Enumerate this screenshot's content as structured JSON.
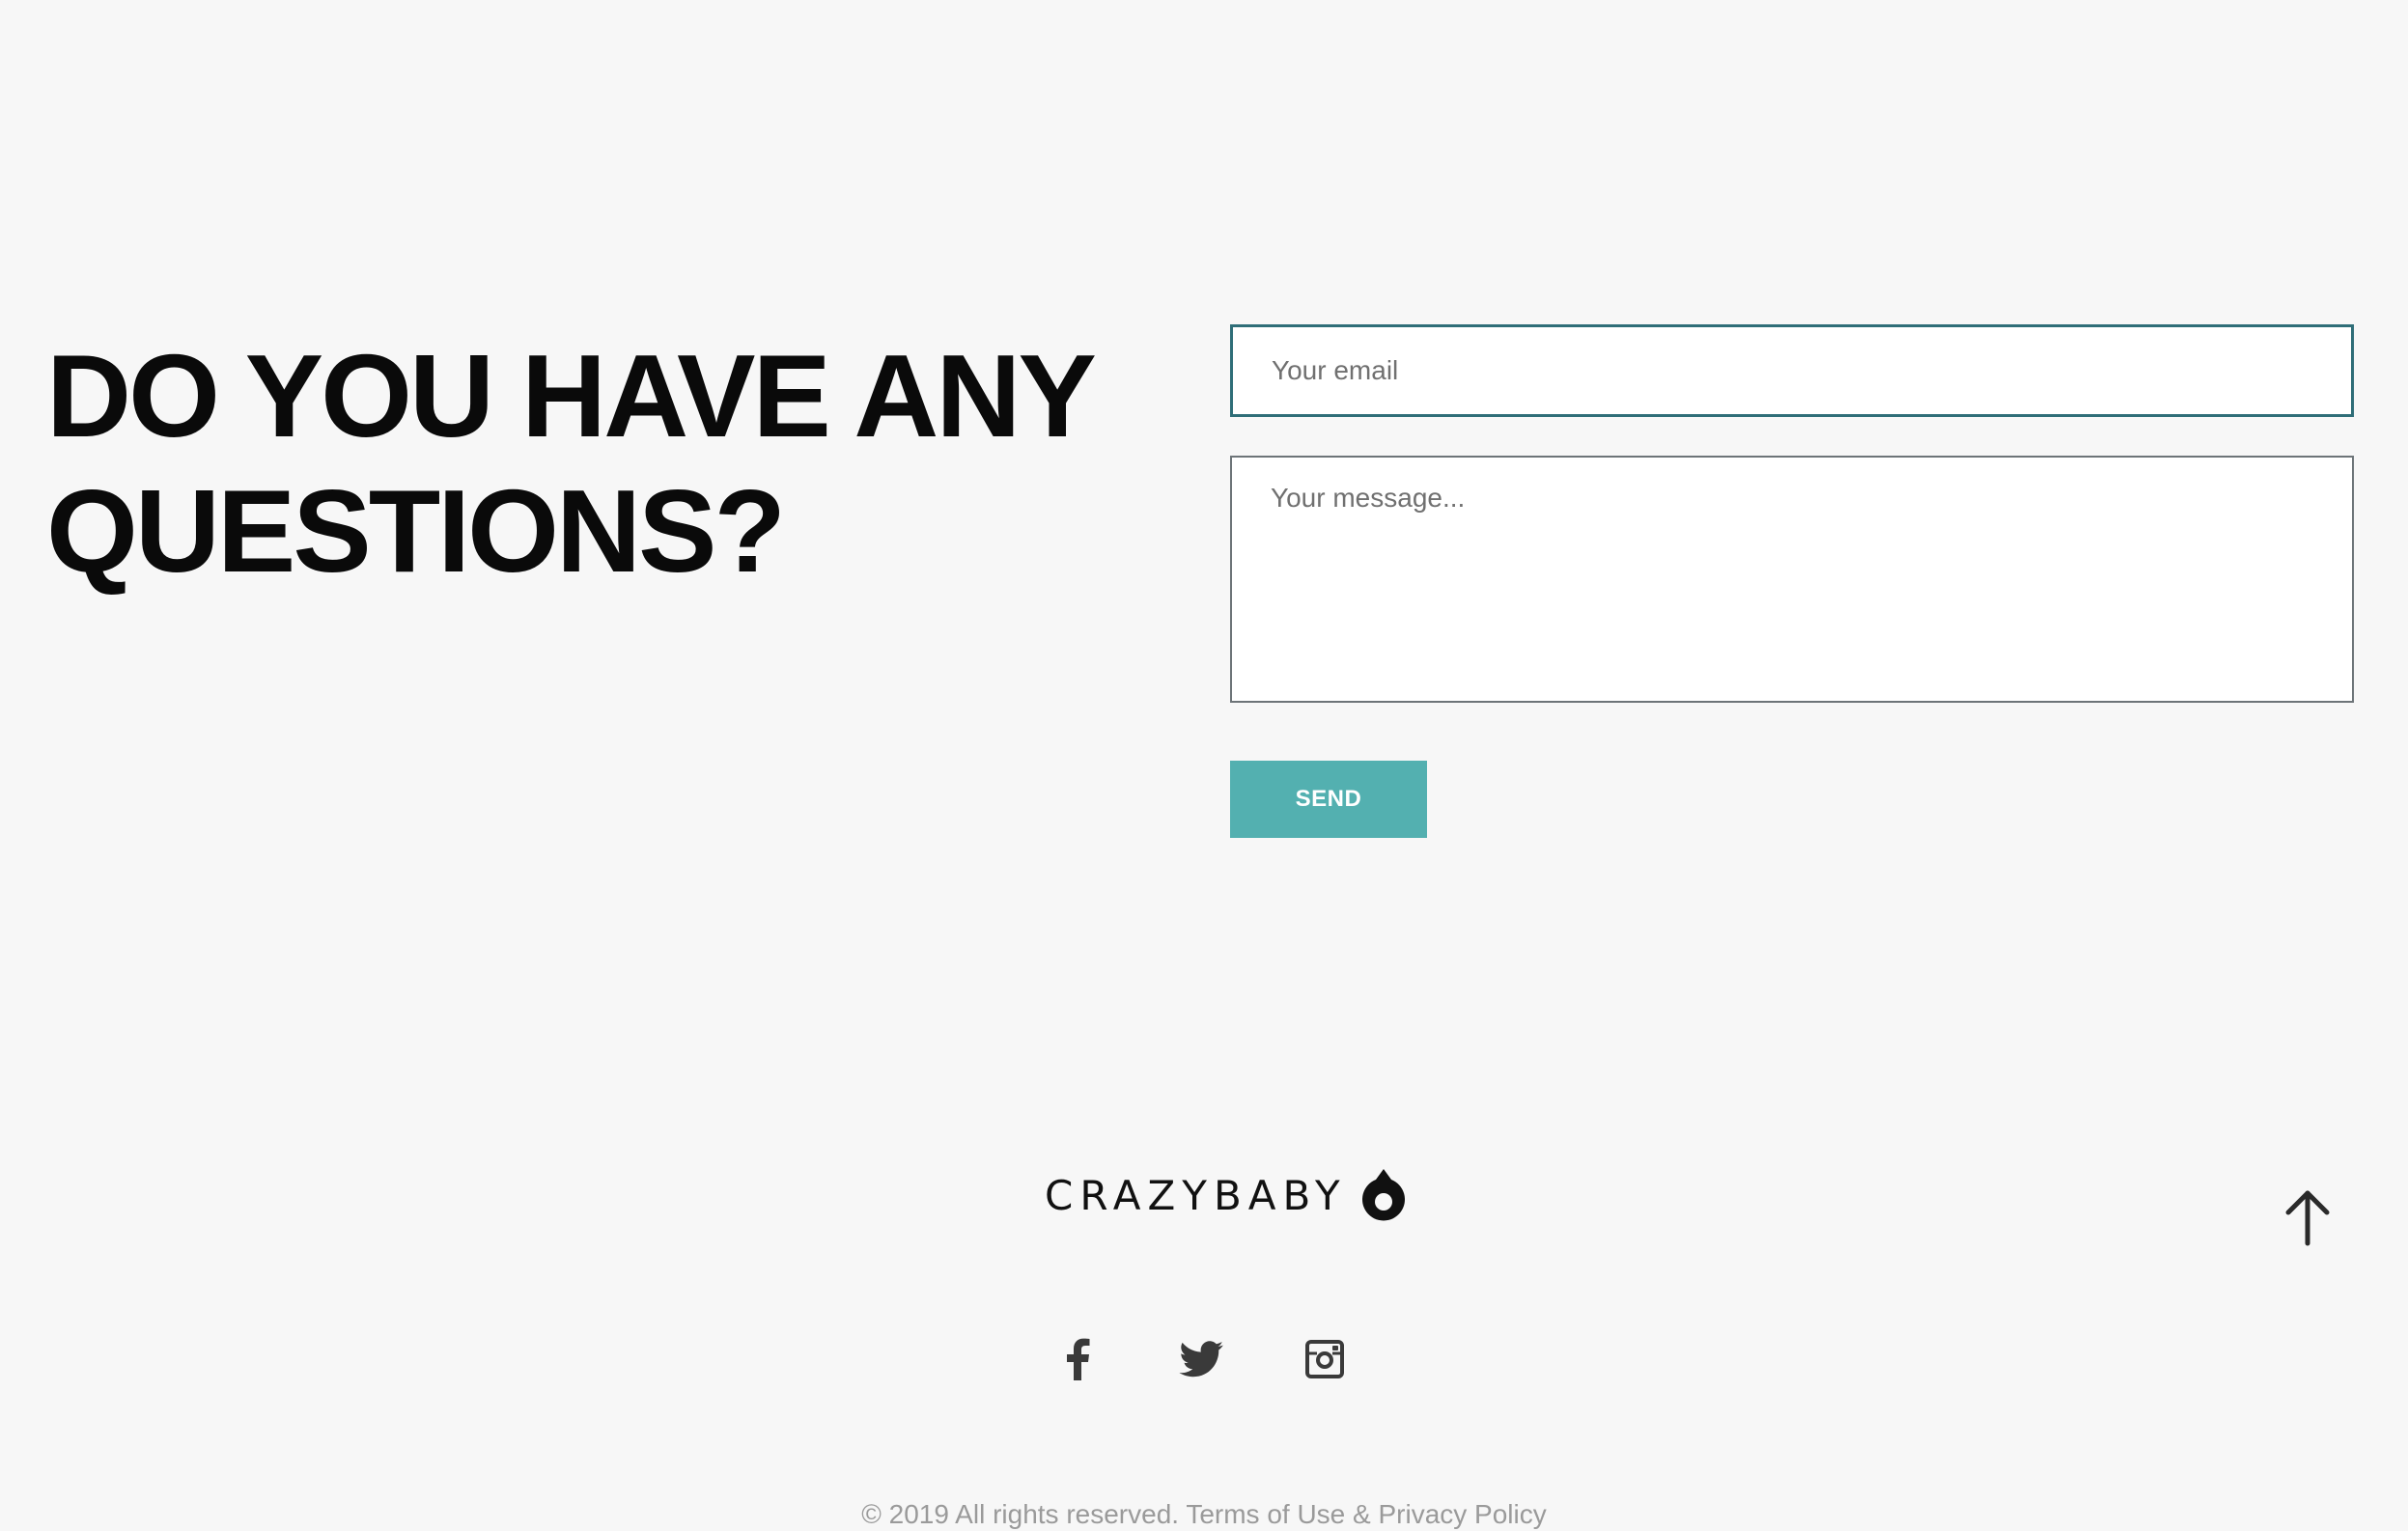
{
  "contact": {
    "heading_line1": "DO YOU HAVE ANY",
    "heading_line2": "QUESTIONS?",
    "email_placeholder": "Your email",
    "message_placeholder": "Your message...",
    "send_label": "SEND"
  },
  "footer": {
    "logo_text": "CRAZYBABY",
    "logo_icon": "droplet-logo-icon",
    "scroll_top_icon": "arrow-up-icon",
    "social": [
      {
        "name": "facebook",
        "icon": "facebook-icon"
      },
      {
        "name": "twitter",
        "icon": "twitter-icon"
      },
      {
        "name": "instagram",
        "icon": "instagram-icon"
      }
    ],
    "copyright": "© 2019 All rights reserved. Terms of Use & Privacy Policy"
  },
  "colors": {
    "background": "#f7f7f7",
    "accent": "#53b0b0",
    "email_border_focus": "#2f6e78",
    "heading": "#0a0a0a",
    "icon": "#3a3a3a",
    "muted_text": "#9a9a9a"
  }
}
